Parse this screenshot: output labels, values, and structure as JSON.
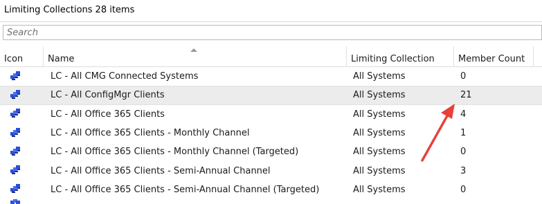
{
  "header": {
    "title": "Limiting Collections",
    "count": "28 items"
  },
  "search": {
    "placeholder": "Search"
  },
  "columns": {
    "icon": "Icon",
    "name": "Name",
    "limiting": "Limiting Collection",
    "member_count": "Member Count"
  },
  "rows": [
    {
      "icon": "collection-icon",
      "name": "LC - All CMG Connected Systems",
      "limiting": "All Systems",
      "count": "0"
    },
    {
      "icon": "collection-icon",
      "name": "LC - All ConfigMgr Clients",
      "limiting": "All Systems",
      "count": "21"
    },
    {
      "icon": "collection-icon",
      "name": "LC - All Office 365 Clients",
      "limiting": "All Systems",
      "count": "4"
    },
    {
      "icon": "collection-icon",
      "name": "LC - All Office 365 Clients - Monthly Channel",
      "limiting": "All Systems",
      "count": "1"
    },
    {
      "icon": "collection-icon",
      "name": "LC - All Office 365 Clients - Monthly Channel (Targeted)",
      "limiting": "All Systems",
      "count": "0"
    },
    {
      "icon": "collection-icon",
      "name": "LC - All Office 365 Clients - Semi-Annual Channel",
      "limiting": "All Systems",
      "count": "3"
    },
    {
      "icon": "collection-icon",
      "name": "LC - All Office 365 Clients - Semi-Annual Channel (Targeted)",
      "limiting": "All Systems",
      "count": "0"
    }
  ],
  "selected_row": 1,
  "colors": {
    "annotation_arrow": "#e8403a",
    "icon_blue": "#2b4fd6",
    "selected_row": "#ececec"
  }
}
